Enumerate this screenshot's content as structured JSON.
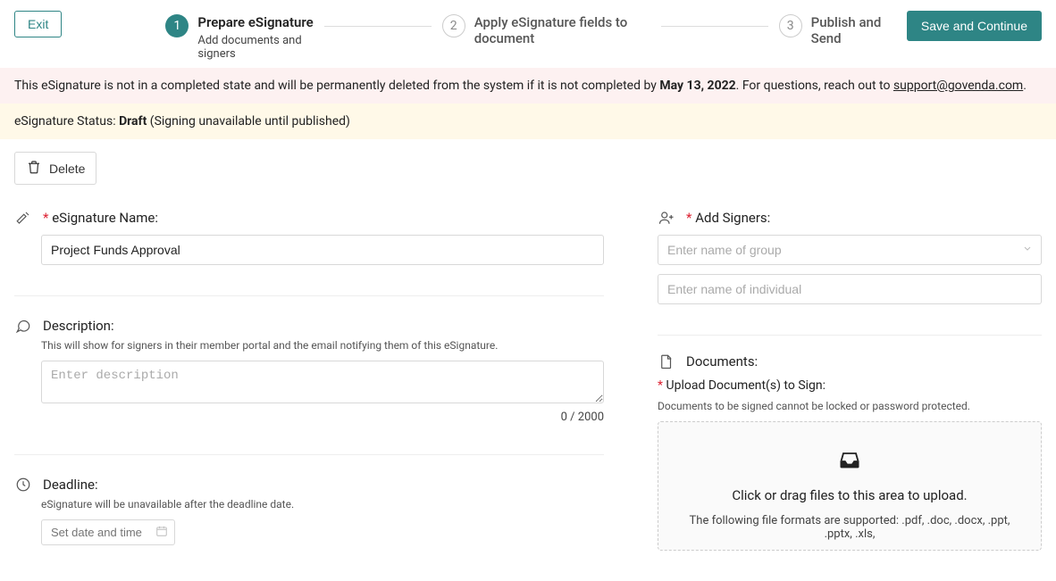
{
  "topbar": {
    "exit": "Exit",
    "save": "Save and Continue"
  },
  "steps": {
    "s1": {
      "num": "1",
      "title": "Prepare eSignature",
      "subtitle": "Add documents and signers"
    },
    "s2": {
      "num": "2",
      "title": "Apply eSignature fields to document"
    },
    "s3": {
      "num": "3",
      "title": "Publish and Send"
    }
  },
  "banners": {
    "pink_prefix": "This eSignature is not in a completed state and will be permanently deleted from the system if it is not completed by ",
    "pink_date": "May 13, 2022",
    "pink_mid": ". For questions, reach out to ",
    "pink_link": "support@govenda.com",
    "pink_suffix": ".",
    "yellow_prefix": "eSignature Status: ",
    "yellow_status": "Draft",
    "yellow_note": " (Signing unavailable until published)"
  },
  "actions": {
    "delete": "Delete"
  },
  "esig_name": {
    "label": "eSignature Name:",
    "value": "Project Funds Approval"
  },
  "description": {
    "label": "Description:",
    "help": "This will show for signers in their member portal and the email notifying them of this eSignature.",
    "placeholder": "Enter description",
    "counter": "0 / 2000"
  },
  "deadline": {
    "label": "Deadline:",
    "help": "eSignature will be unavailable after the deadline date.",
    "placeholder": "Set date and time"
  },
  "signers": {
    "label": "Add Signers:",
    "group_placeholder": "Enter name of group",
    "individual_placeholder": "Enter name of individual"
  },
  "documents": {
    "label": "Documents:",
    "upload_label": "Upload Document(s) to Sign:",
    "help": "Documents to be signed cannot be locked or password protected.",
    "drop_title": "Click or drag files to this area to upload.",
    "drop_sub": "The following file formats are supported: .pdf, .doc, .docx, .ppt, .pptx, .xls,"
  }
}
